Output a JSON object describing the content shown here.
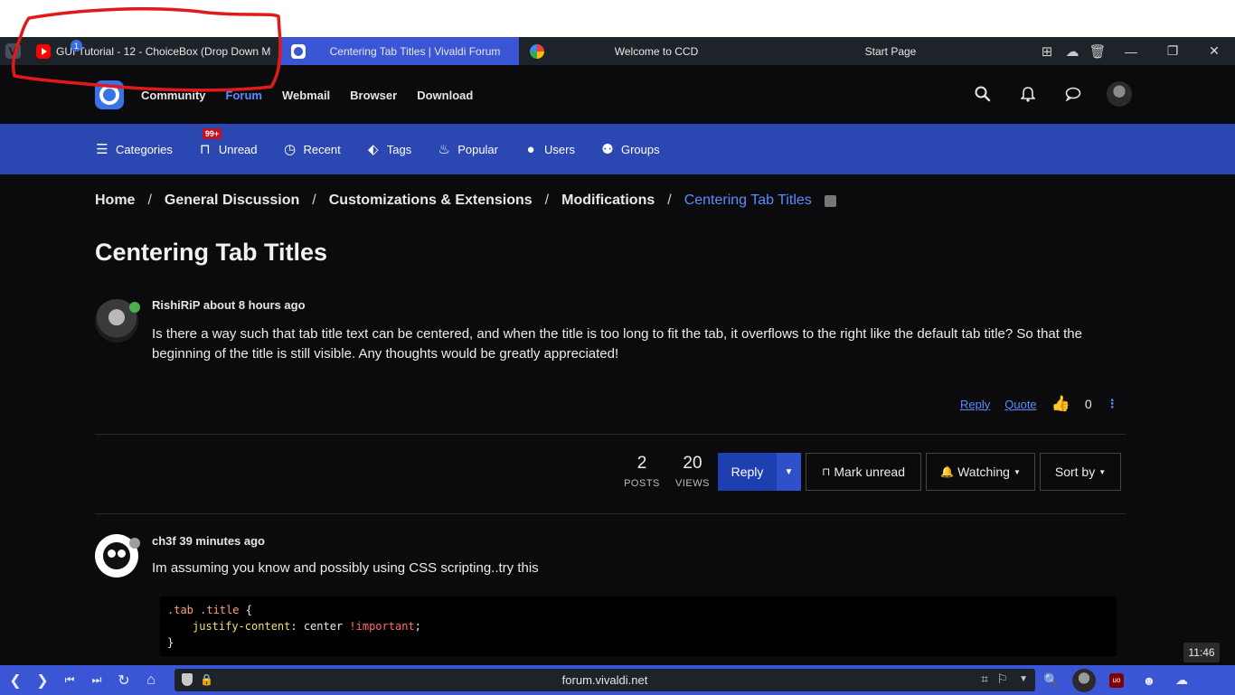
{
  "browser": {
    "tabs": [
      {
        "title": "GUI Tutorial - 12 - ChoiceBox (Drop Down M",
        "badge": "1",
        "icon": "youtube-icon"
      },
      {
        "title": "Centering Tab Titles | Vivaldi Forum",
        "icon": "vivaldi-icon"
      },
      {
        "title": "Welcome to CCD",
        "icon": "chrome-icon"
      },
      {
        "title": "Start Page",
        "icon": ""
      }
    ],
    "url": "forum.vivaldi.net",
    "clock": "11:46"
  },
  "forum_header": {
    "nav": [
      {
        "label": "Community"
      },
      {
        "label": "Forum"
      },
      {
        "label": "Webmail"
      },
      {
        "label": "Browser"
      },
      {
        "label": "Download"
      }
    ]
  },
  "sub_nav": {
    "items": [
      {
        "label": "Categories",
        "icon": "list-icon"
      },
      {
        "label": "Unread",
        "icon": "inbox-icon",
        "badge": "99+"
      },
      {
        "label": "Recent",
        "icon": "clock-icon"
      },
      {
        "label": "Tags",
        "icon": "tag-icon"
      },
      {
        "label": "Popular",
        "icon": "fire-icon"
      },
      {
        "label": "Users",
        "icon": "user-icon"
      },
      {
        "label": "Groups",
        "icon": "group-icon"
      }
    ]
  },
  "breadcrumb": {
    "items": [
      "Home",
      "General Discussion",
      "Customizations & Extensions",
      "Modifications"
    ],
    "separator": "/",
    "current": "Centering Tab Titles"
  },
  "topic": {
    "title": "Centering Tab Titles",
    "first_post": {
      "author": "RishiRiP",
      "time": "about 8 hours ago",
      "body": "Is there a way such that tab title text can be centered, and when the title is too long to fit the tab, it overflows to the right like the default tab title? So that the beginning of the title is still visible. Any thoughts would be greatly appreciated!",
      "reply_label": "Reply",
      "quote_label": "Quote",
      "votes": "0"
    },
    "stats": {
      "posts_count": "2",
      "posts_label": "POSTS",
      "views_count": "20",
      "views_label": "VIEWS"
    },
    "toolbar": {
      "reply_label": "Reply",
      "mark_unread_label": "Mark unread",
      "watching_label": "Watching",
      "sort_label": "Sort by"
    },
    "second_post": {
      "author": "ch3f",
      "time": "39 minutes ago",
      "body": "Im assuming you know and possibly using CSS scripting..try this",
      "code": {
        "selector": ".tab .title",
        "open_brace": " {",
        "property": "justify-content",
        "colon": ":",
        "value": " center ",
        "important": "!important",
        "semicolon": ";",
        "close_brace": "}"
      }
    }
  },
  "colors": {
    "accent": "#3a56d4",
    "forum_blue": "#2b47b2",
    "link": "#5a8cff",
    "annotation": "#e01a1a"
  }
}
